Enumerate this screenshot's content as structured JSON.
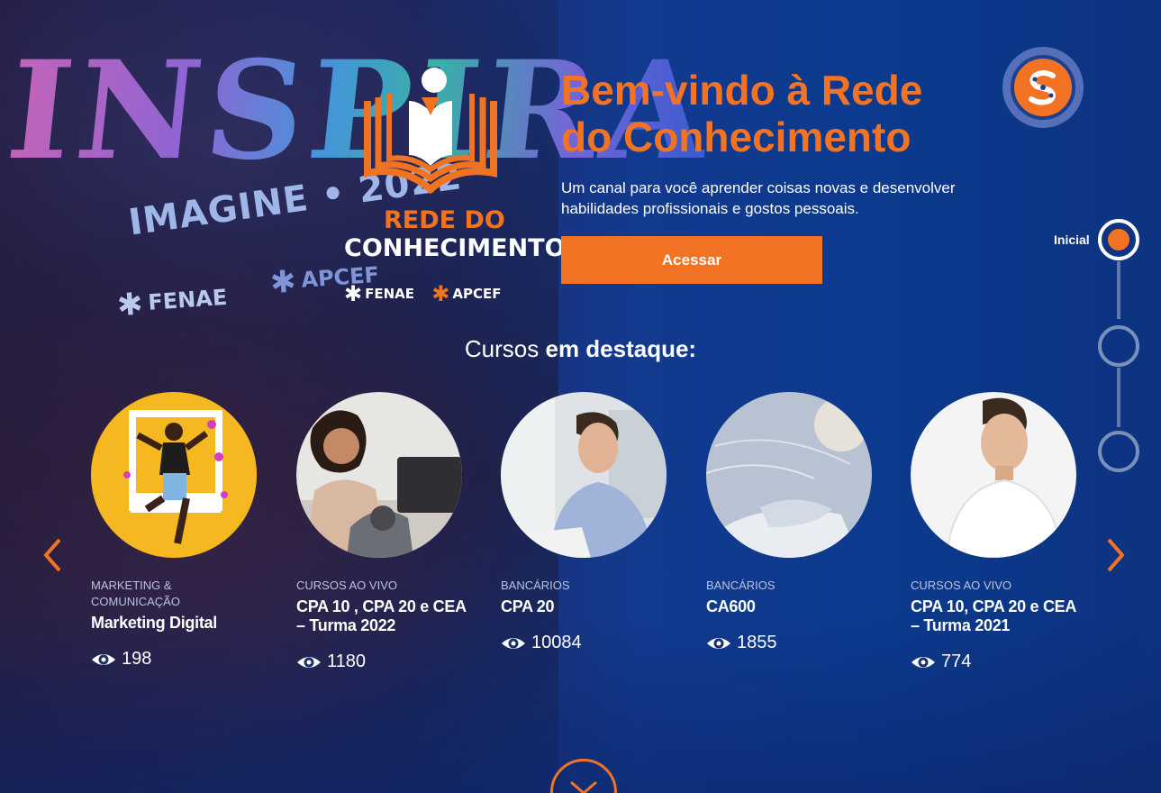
{
  "art": {
    "word": "INSPIRA",
    "imagine": "IMAGINE • 2022",
    "fenae": "FENAE",
    "apcef": "APCEF"
  },
  "logo": {
    "line1": "REDE DO",
    "line2": "CONHECIMENTO",
    "partner1": "FENAE",
    "partner2": "APCEF"
  },
  "hero": {
    "title": "Bem-vindo à Rede do Conhecimento",
    "subtitle": "Um canal para você aprender coisas novas e desenvolver habilidades profissionais e gostos pessoais.",
    "button": "Acessar"
  },
  "nav": {
    "label": "Inicial",
    "dots": 3,
    "active": 0
  },
  "section": {
    "title_light": "Cursos ",
    "title_strong": "em destaque:"
  },
  "courses": [
    {
      "category": "MARKETING & COMUNICAÇÃO",
      "title": "Marketing Digital",
      "views": "198"
    },
    {
      "category": "CURSOS AO VIVO",
      "title": "CPA 10 , CPA 20 e CEA – Turma 2022",
      "views": "1180"
    },
    {
      "category": "BANCÁRIOS",
      "title": "CPA 20",
      "views": "10084"
    },
    {
      "category": "BANCÁRIOS",
      "title": "CA600",
      "views": "1855"
    },
    {
      "category": "CURSOS AO VIVO",
      "title": "CPA 10, CPA 20 e CEA – Turma 2021",
      "views": "774"
    }
  ],
  "colors": {
    "accent": "#f37324",
    "background": "#0e2f7a"
  },
  "icons": {
    "prev": "chevron-left-icon",
    "next": "chevron-right-icon",
    "views": "eye-icon",
    "scroll": "chevron-down-icon"
  }
}
